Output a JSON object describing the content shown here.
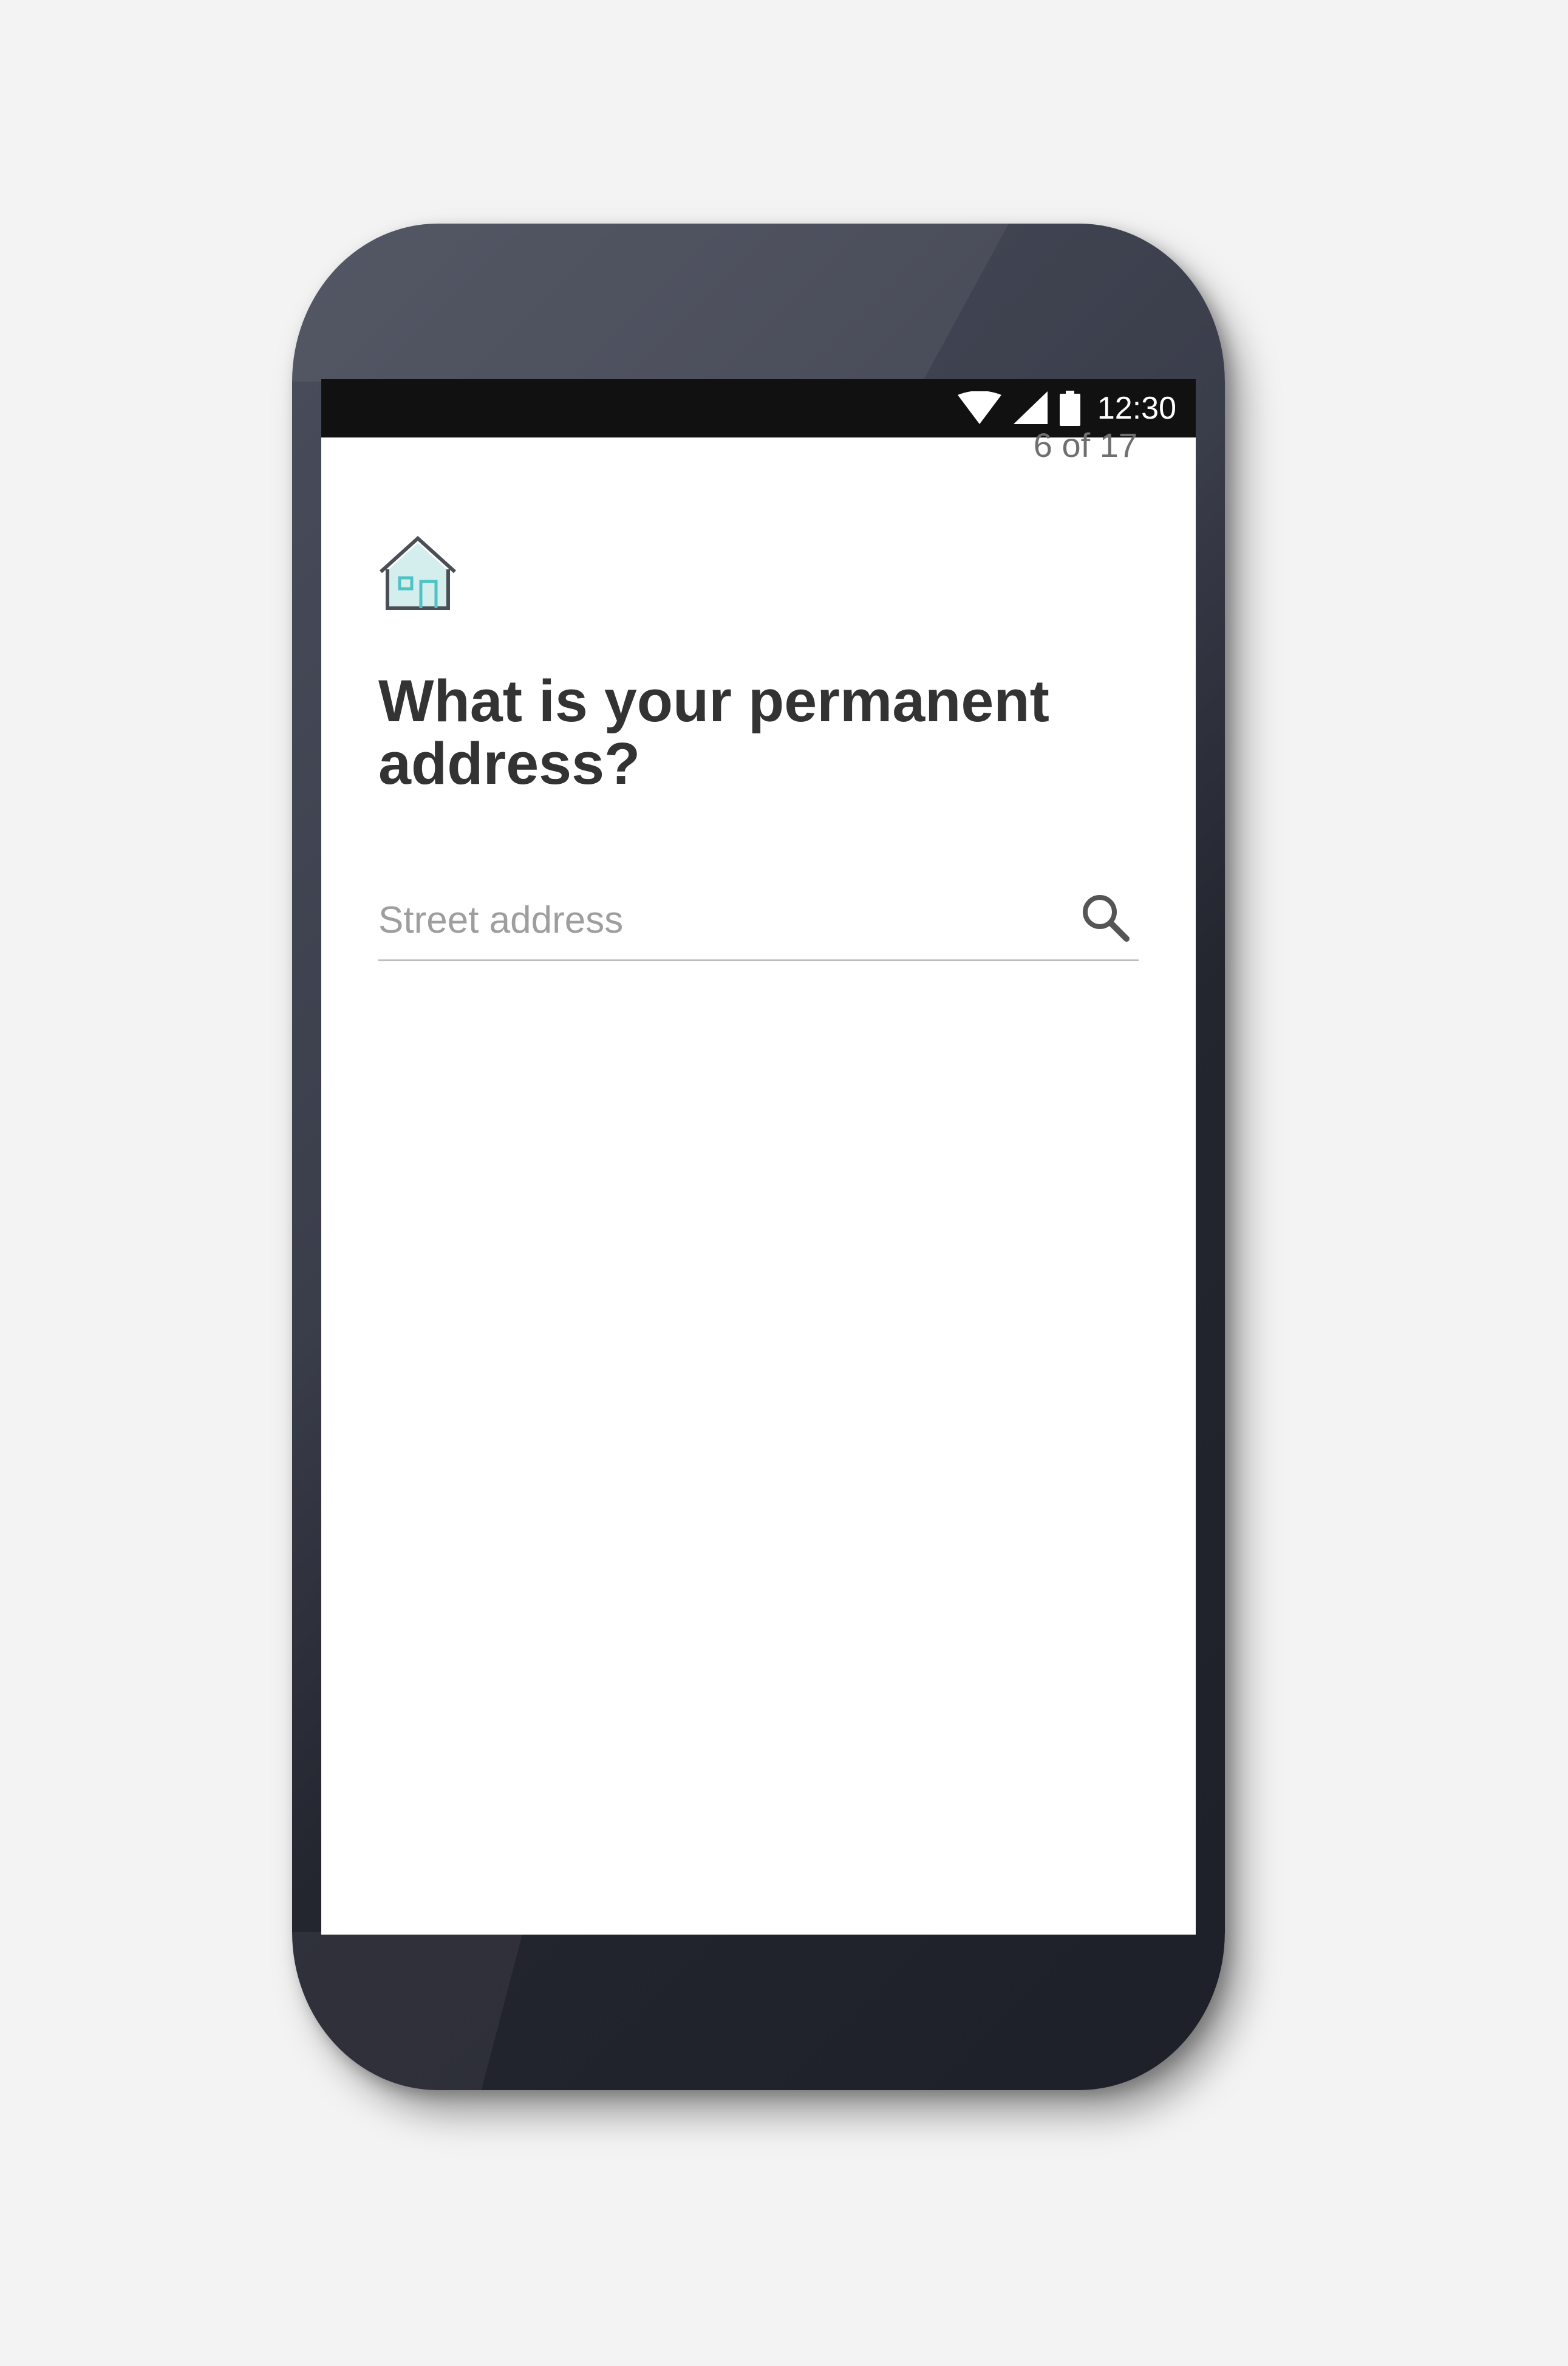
{
  "status_bar": {
    "time": "12:30",
    "icons": [
      "wifi-icon",
      "cell-signal-icon",
      "battery-icon"
    ]
  },
  "progress": {
    "label": "6 of 17",
    "current": 6,
    "total": 17
  },
  "question": {
    "icon": "house-icon",
    "title": "What is your permanent address?"
  },
  "address_input": {
    "placeholder": "Street address",
    "value": "",
    "icon": "search-icon"
  },
  "colors": {
    "background": "#f3f3f3",
    "device_body": "#2a2c37",
    "status_bar": "#111111",
    "screen": "#ffffff",
    "title_text": "#333333",
    "counter_text": "#6f6f6f",
    "placeholder_text": "#9e9e9e",
    "underline": "#bdbdbd",
    "icon_accent": "#4fc3c3",
    "icon_fill": "#d4eeee",
    "icon_outline": "#4a4e55"
  }
}
